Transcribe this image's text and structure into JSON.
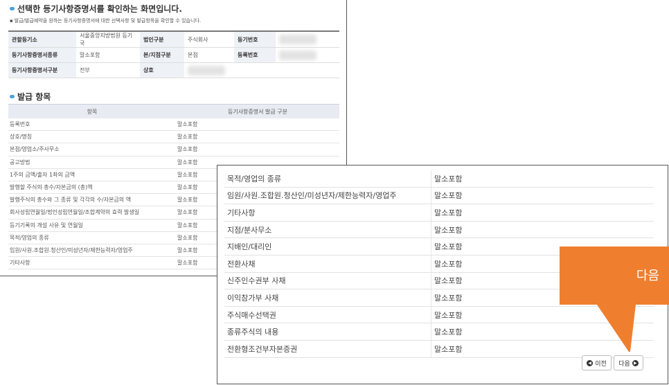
{
  "panel1": {
    "title": "선택한 등기사항증명서를 확인하는 화면입니다.",
    "notice": "발급/발급예약을 원하는 등기사항증명서에 대한 선택사항 및 발급항목을 확인할 수 있습니다.",
    "info": {
      "court_label": "관할등기소",
      "court_value": "서울중앙지방법원 등기국",
      "corp_type_label": "법인구분",
      "corp_type_value": "주식회사",
      "reg_no_label": "등기번호",
      "cert_type_label": "등기사항증명서종류",
      "cert_type_value": "말소포함",
      "branch_label": "본/지점구분",
      "branch_value": "본점",
      "reg_num_label": "등록번호",
      "cert_div_label": "등기사항증명서구분",
      "cert_div_value": "전부",
      "trade_name_label": "상호"
    },
    "section2_title": "발급 항목",
    "table_headers": [
      "항목",
      "등기사항증명서 발급 구분"
    ],
    "rows": [
      {
        "item": "등록번호",
        "value": "말소포함"
      },
      {
        "item": "상호/명칭",
        "value": "말소포함"
      },
      {
        "item": "본점/영업소/주사무소",
        "value": "말소포함"
      },
      {
        "item": "공고방법",
        "value": "말소포함"
      },
      {
        "item": "1주의 금액/출자 1좌의 금액",
        "value": "말소포함"
      },
      {
        "item": "발행할 주식의 총수/자본금의 (총)액",
        "value": "말소포함"
      },
      {
        "item": "발행주식의 총수와 그 종류 및 각각의 수/자본금의 액",
        "value": "말소포함"
      },
      {
        "item": "회사성립연월일/법인성립연월일/조합계약의 효력 발생일",
        "value": "말소포함"
      },
      {
        "item": "등기기록의 개설 사유 및 연월일",
        "value": "말소포함"
      },
      {
        "item": "목적/영업의 종류",
        "value": "말소포함"
      },
      {
        "item": "임원/사원.조합원.청산인/미성년자/제한능력자/영업주",
        "value": "말소포함"
      },
      {
        "item": "기타사항",
        "value": "말소포함"
      }
    ]
  },
  "panel2": {
    "rows": [
      {
        "item": "목적/영업의 종류",
        "value": "말소포함"
      },
      {
        "item": "임원/사원.조합원.청산인/미성년자/제한능력자/영업주",
        "value": "말소포함"
      },
      {
        "item": "기타사항",
        "value": "말소포함"
      },
      {
        "item": "지점/분사무소",
        "value": "말소포함"
      },
      {
        "item": "지배인/대리인",
        "value": "말소포함"
      },
      {
        "item": "전환사채",
        "value": "말소포함"
      },
      {
        "item": "신주인수권부 사채",
        "value": "말소포함"
      },
      {
        "item": "이익참가부 사채",
        "value": "말소포함"
      },
      {
        "item": "주식매수선택권",
        "value": "말소포함"
      },
      {
        "item": "종류주식의 내용",
        "value": "말소포함"
      },
      {
        "item": "전환형조건부자본증권",
        "value": "말소포함"
      }
    ],
    "prev_label": "이전",
    "next_label": "다음"
  },
  "callout": {
    "text": "다음",
    "color": "#ef7f2f"
  }
}
